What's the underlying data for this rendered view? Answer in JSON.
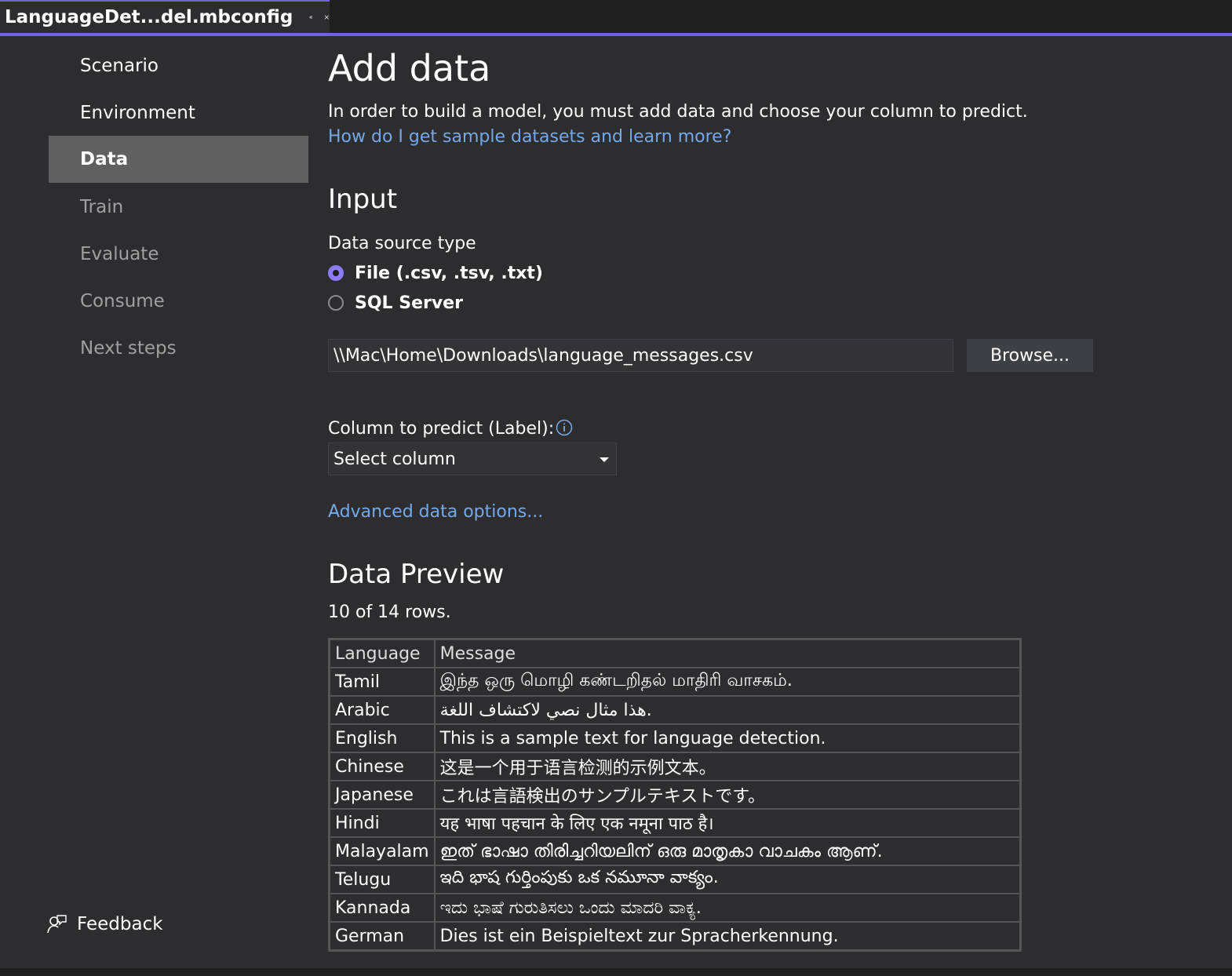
{
  "tab": {
    "title": "LanguageDet...del.mbconfig",
    "pin_icon": "pin-icon",
    "close_icon": "close-icon"
  },
  "colors": {
    "accent": "#7160e8",
    "link": "#74a9e9",
    "active_nav": "#606060",
    "background": "#2d2d30"
  },
  "sidebar": {
    "items": [
      {
        "label": "Scenario",
        "state": "done"
      },
      {
        "label": "Environment",
        "state": "done"
      },
      {
        "label": "Data",
        "state": "active"
      },
      {
        "label": "Train",
        "state": "todo"
      },
      {
        "label": "Evaluate",
        "state": "todo"
      },
      {
        "label": "Consume",
        "state": "todo"
      },
      {
        "label": "Next steps",
        "state": "todo"
      }
    ],
    "feedback": "Feedback"
  },
  "main": {
    "title": "Add data",
    "description": "In order to build a model, you must add data and choose your column to predict.",
    "help_link": "How do I get sample datasets and learn more?",
    "input_heading": "Input",
    "source_type_label": "Data source type",
    "source_options": [
      {
        "label": "File (.csv, .tsv, .txt)",
        "selected": true
      },
      {
        "label": "SQL Server",
        "selected": false
      }
    ],
    "file_path": "\\\\Mac\\Home\\Downloads\\language_messages.csv",
    "browse_label": "Browse...",
    "column_label": "Column to predict (Label):",
    "column_select": "Select column",
    "advanced_link": "Advanced data options...",
    "preview_heading": "Data Preview",
    "row_count": "10 of 14 rows."
  },
  "preview": {
    "columns": [
      "Language",
      "Message"
    ],
    "rows": [
      [
        "Tamil",
        "இந்த ஒரு மொழி கண்டறிதல் மாதிரி வாசகம்."
      ],
      [
        "Arabic",
        "هذا مثال نصي لاكتشاف اللغة."
      ],
      [
        "English",
        "This is a sample text for language detection."
      ],
      [
        "Chinese",
        "这是一个用于语言检测的示例文本。"
      ],
      [
        "Japanese",
        "これは言語検出のサンプルテキストです。"
      ],
      [
        "Hindi",
        "यह भाषा पहचान के लिए एक नमूना पाठ है।"
      ],
      [
        "Malayalam",
        "ഇത് ഭാഷാ തിരിച്ചറിയലിന് ഒരു മാതൃകാ വാചകം ആണ്."
      ],
      [
        "Telugu",
        "ఇది భాష గుర్తింపుకు ఒక నమూనా వాక్యం."
      ],
      [
        "Kannada",
        "ಇದು ಭಾಷೆ ಗುರುತಿಸಲು ಒಂದು ಮಾದರಿ ವಾಕ್ಯ."
      ],
      [
        "German",
        "Dies ist ein Beispieltext zur Spracherkennung."
      ]
    ]
  }
}
